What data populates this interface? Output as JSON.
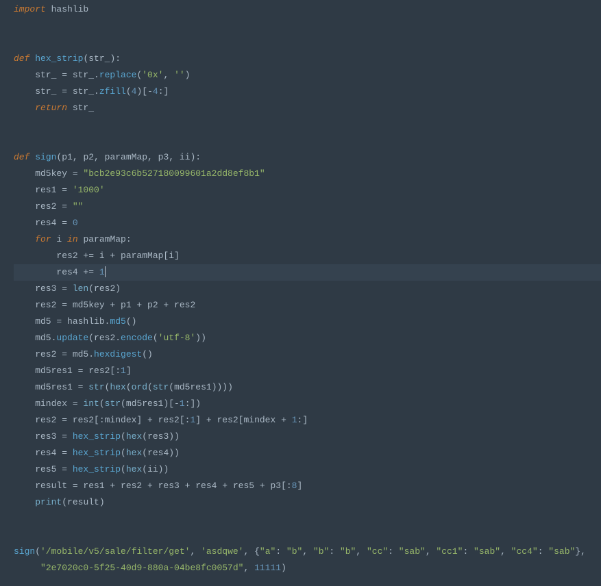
{
  "code": {
    "line1": {
      "t1": "import",
      "t2": " hashlib"
    },
    "line4": {
      "t1": "def",
      "t2": " ",
      "t3": "hex_strip",
      "t4": "(str_):"
    },
    "line5": {
      "t1": "    str_ = str_.",
      "t2": "replace",
      "t3": "(",
      "t4": "'0x'",
      "t5": ", ",
      "t6": "''",
      "t7": ")"
    },
    "line6": {
      "t1": "    str_ = str_.",
      "t2": "zfill",
      "t3": "(",
      "t4": "4",
      "t5": ")[-",
      "t6": "4",
      "t7": ":]"
    },
    "line7": {
      "t1": "    ",
      "t2": "return",
      "t3": " str_"
    },
    "line10": {
      "t1": "def",
      "t2": " ",
      "t3": "sign",
      "t4": "(p1, p2, paramMap, p3, ii):"
    },
    "line11": {
      "t1": "    md5key = ",
      "t2": "\"bcb2e93c6b527180099601a2dd8ef8b1\""
    },
    "line12": {
      "t1": "    res1 = ",
      "t2": "'1000'"
    },
    "line13": {
      "t1": "    res2 = ",
      "t2": "\"\""
    },
    "line14": {
      "t1": "    res4 = ",
      "t2": "0"
    },
    "line15": {
      "t1": "    ",
      "t2": "for",
      "t3": " i ",
      "t4": "in",
      "t5": " paramMap:"
    },
    "line16": {
      "t1": "        res2 += i + paramMap[i]"
    },
    "line17": {
      "t1": "        res4 += ",
      "t2": "1"
    },
    "line18": {
      "t1": "    res3 = ",
      "t2": "len",
      "t3": "(res2)"
    },
    "line19": {
      "t1": "    res2 = md5key + p1 + p2 + res2"
    },
    "line20": {
      "t1": "    md5 = hashlib.",
      "t2": "md5",
      "t3": "()"
    },
    "line21": {
      "t1": "    md5.",
      "t2": "update",
      "t3": "(res2.",
      "t4": "encode",
      "t5": "(",
      "t6": "'utf-8'",
      "t7": "))"
    },
    "line22": {
      "t1": "    res2 = md5.",
      "t2": "hexdigest",
      "t3": "()"
    },
    "line23": {
      "t1": "    md5res1 = res2[:",
      "t2": "1",
      "t3": "]"
    },
    "line24": {
      "t1": "    md5res1 = ",
      "t2": "str",
      "t3": "(",
      "t4": "hex",
      "t5": "(",
      "t6": "ord",
      "t7": "(",
      "t8": "str",
      "t9": "(md5res1))))"
    },
    "line25": {
      "t1": "    mindex = ",
      "t2": "int",
      "t3": "(",
      "t4": "str",
      "t5": "(md5res1)[-",
      "t6": "1",
      "t7": ":])"
    },
    "line26": {
      "t1": "    res2 = res2[:mindex] + res2[:",
      "t2": "1",
      "t3": "] + res2[mindex + ",
      "t4": "1",
      "t5": ":]"
    },
    "line27": {
      "t1": "    res3 = ",
      "t2": "hex_strip",
      "t3": "(",
      "t4": "hex",
      "t5": "(res3))"
    },
    "line28": {
      "t1": "    res4 = ",
      "t2": "hex_strip",
      "t3": "(",
      "t4": "hex",
      "t5": "(res4))"
    },
    "line29": {
      "t1": "    res5 = ",
      "t2": "hex_strip",
      "t3": "(",
      "t4": "hex",
      "t5": "(ii))"
    },
    "line30": {
      "t1": "    result = res1 + res2 + res3 + res4 + res5 + p3[:",
      "t2": "8",
      "t3": "]"
    },
    "line31": {
      "t1": "    ",
      "t2": "print",
      "t3": "(result)"
    },
    "line34": {
      "t1": "sign",
      "t2": "(",
      "t3": "'/mobile/v5/sale/filter/get'",
      "t4": ", ",
      "t5": "'asdqwe'",
      "t6": ", {",
      "t7": "\"a\"",
      "t8": ": ",
      "t9": "\"b\"",
      "t10": ", ",
      "t11": "\"b\"",
      "t12": ": ",
      "t13": "\"b\"",
      "t14": ", ",
      "t15": "\"cc\"",
      "t16": ": ",
      "t17": "\"sab\"",
      "t18": ", ",
      "t19": "\"cc1\"",
      "t20": ": ",
      "t21": "\"sab\"",
      "t22": ", ",
      "t23": "\"cc4\"",
      "t24": ": ",
      "t25": "\"sab\"",
      "t26": "},"
    },
    "line35": {
      "t1": "     ",
      "t2": "\"2e7020c0-5f25-40d9-880a-04be8fc0057d\"",
      "t3": ", ",
      "t4": "11111",
      "t5": ")"
    }
  }
}
